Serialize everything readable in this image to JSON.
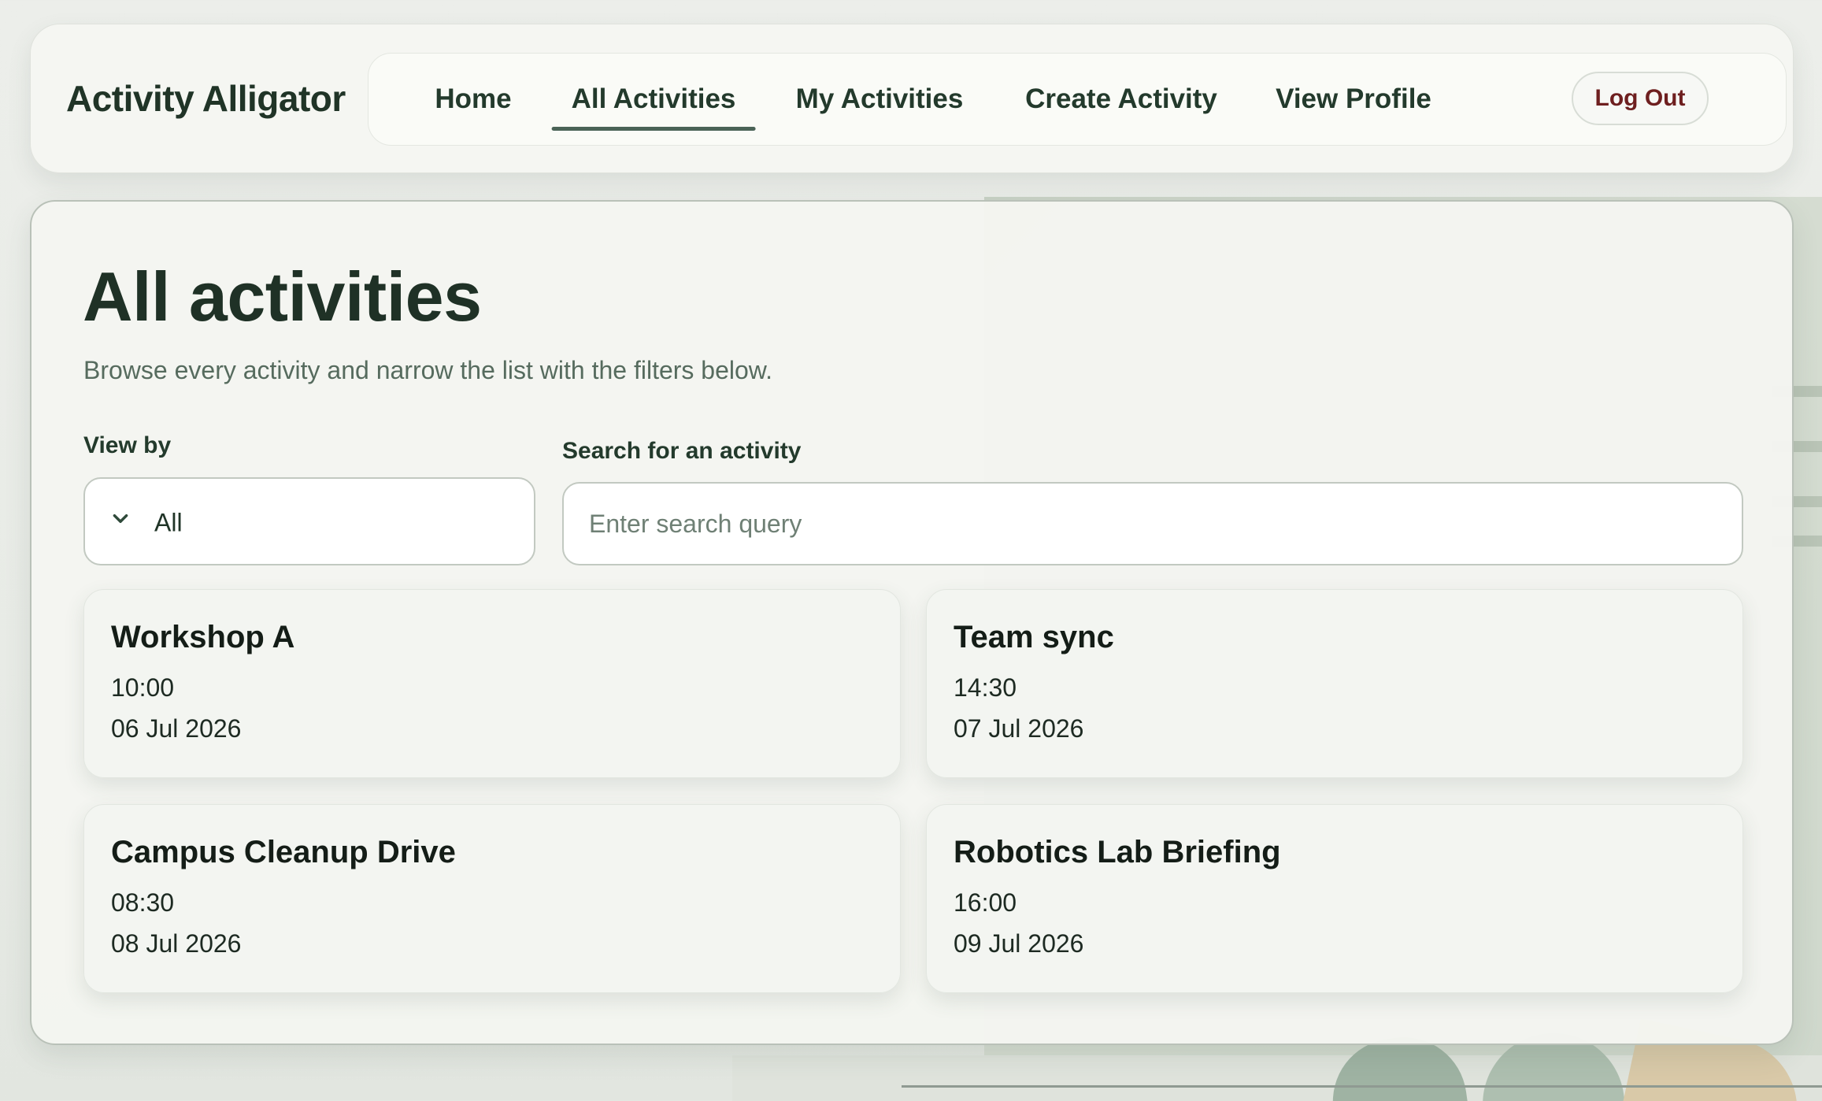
{
  "header": {
    "brand": "Activity Alligator",
    "nav": [
      {
        "label": "Home",
        "active": false
      },
      {
        "label": "All Activities",
        "active": true
      },
      {
        "label": "My Activities",
        "active": false
      },
      {
        "label": "Create Activity",
        "active": false
      },
      {
        "label": "View Profile",
        "active": false
      }
    ],
    "logout_label": "Log Out"
  },
  "main": {
    "title": "All activities",
    "subtitle": "Browse every activity and narrow the list with the filters below.",
    "view_by": {
      "label": "View by",
      "selected": "All",
      "icon": "chevron-down-icon"
    },
    "search": {
      "label": "Search for an activity",
      "placeholder": "Enter search query",
      "value": ""
    },
    "activities": [
      {
        "title": "Workshop A",
        "time": "10:00",
        "date": "06 Jul 2026"
      },
      {
        "title": "Team sync",
        "time": "14:30",
        "date": "07 Jul 2026"
      },
      {
        "title": "Campus Cleanup Drive",
        "time": "08:30",
        "date": "08 Jul 2026"
      },
      {
        "title": "Robotics Lab Briefing",
        "time": "16:00",
        "date": "09 Jul 2026"
      }
    ]
  },
  "colors": {
    "accent": "#4a6357",
    "logout_text": "#6e1f1f",
    "title_text": "#1f3126",
    "background": "#eceeea"
  }
}
